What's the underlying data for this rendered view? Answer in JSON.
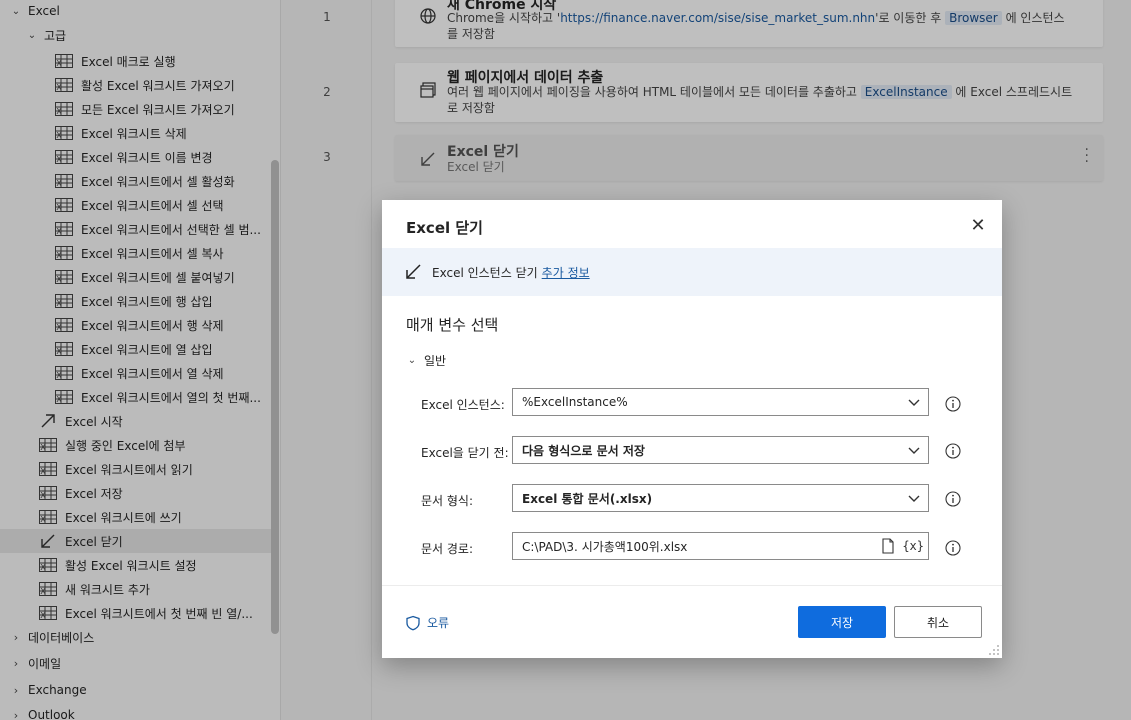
{
  "sidebar": {
    "excel_group": "Excel",
    "advanced_group": "고급",
    "advanced_items": [
      "Excel 매크로 실행",
      "활성 Excel 워크시트 가져오기",
      "모든 Excel 워크시트 가져오기",
      "Excel 워크시트 삭제",
      "Excel 워크시트 이름 변경",
      "Excel 워크시트에서 셀 활성화",
      "Excel 워크시트에서 셀 선택",
      "Excel 워크시트에서 선택한 셀 범...",
      "Excel 워크시트에서 셀 복사",
      "Excel 워크시트에 셀 붙여넣기",
      "Excel 워크시트에 행 삽입",
      "Excel 워크시트에서 행 삭제",
      "Excel 워크시트에 열 삽입",
      "Excel 워크시트에서 열 삭제",
      "Excel 워크시트에서 열의 첫 번째..."
    ],
    "excel_items": [
      "Excel 시작",
      "실행 중인 Excel에 첨부",
      "Excel 워크시트에서 읽기",
      "Excel 저장",
      "Excel 워크시트에 쓰기",
      "Excel 닫기",
      "활성 Excel 워크시트 설정",
      "새 워크시트 추가",
      "Excel 워크시트에서 첫 번째 빈 열/..."
    ],
    "other_groups": [
      "데이터베이스",
      "이메일",
      "Exchange",
      "Outlook"
    ]
  },
  "flow": {
    "steps": [
      {
        "num": "1",
        "title": "새 Chrome 시작",
        "desc_pre": "Chrome을 시작하고 '",
        "desc_link": "https://finance.naver.com/sise/sise_market_sum.nhn",
        "desc_mid": "'로 이동한 후 ",
        "desc_chip": "Browser",
        "desc_post": " 에 인스턴스를 저장함"
      },
      {
        "num": "2",
        "title": "웹 페이지에서 데이터 추출",
        "desc_pre": "여러 웹 페이지에서 페이징을 사용하여 HTML 테이블에서 모든 데이터를 추출하고 ",
        "desc_chip": "ExcelInstance",
        "desc_post": " 에 Excel 스프레드시트로 저장함"
      },
      {
        "num": "3",
        "title": "Excel 닫기",
        "desc": "Excel 닫기"
      }
    ]
  },
  "dialog": {
    "title": "Excel 닫기",
    "info_text": "Excel 인스턴스 닫기",
    "info_link": "추가 정보",
    "section_title": "매개 변수 선택",
    "group_label": "일반",
    "fields": [
      {
        "label": "Excel 인스턴스:",
        "value": "%ExcelInstance%"
      },
      {
        "label": "Excel을 닫기 전:",
        "value": "다음 형식으로 문서 저장"
      },
      {
        "label": "문서 형식:",
        "value": "Excel 통합 문서(.xlsx)"
      },
      {
        "label": "문서 경로:",
        "value": "C:\\PAD\\3. 시가총액100위.xlsx",
        "var_button": "{x}"
      }
    ],
    "error_link": "오류",
    "save_label": "저장",
    "cancel_label": "취소"
  },
  "colors": {
    "primary": "#0f6cde",
    "link": "#1a5aa0",
    "info_bar_bg": "#eef3fa"
  }
}
